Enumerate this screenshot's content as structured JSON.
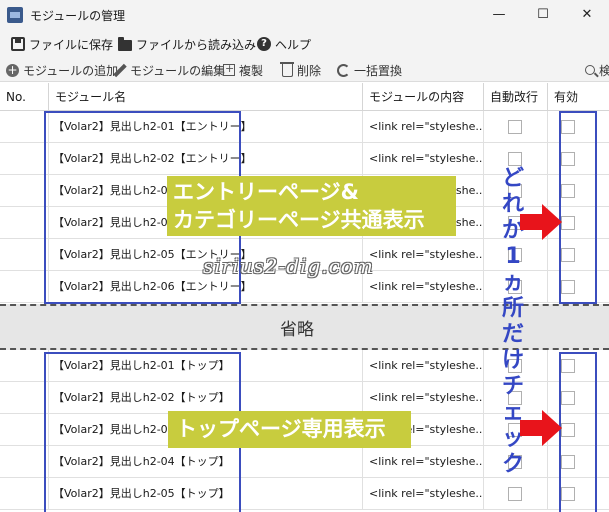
{
  "window": {
    "title": "モジュールの管理",
    "minimize": "—",
    "maximize": "☐",
    "close": "✕"
  },
  "menu": {
    "save_label": "ファイルに保存",
    "load_label": "ファイルから読み込み",
    "help_label": "ヘルプ"
  },
  "toolbar": {
    "add_label": "モジュールの追加",
    "edit_label": "モジュールの編集",
    "duplicate_label": "複製",
    "delete_label": "削除",
    "replace_label": "一括置換",
    "search_label": "検"
  },
  "table": {
    "columns": {
      "no": "No.",
      "name": "モジュール名",
      "content": "モジュールの内容",
      "auto_wrap": "自動改行",
      "enabled": "有効"
    },
    "rows_top": [
      {
        "name": "【Volar2】見出しh2-01【エントリー】",
        "content": "<link rel=\"styleshe..."
      },
      {
        "name": "【Volar2】見出しh2-02【エントリー】",
        "content": "<link rel=\"styleshe..."
      },
      {
        "name": "【Volar2】見出しh2-03",
        "content": "<link rel=\"styleshe..."
      },
      {
        "name": "【Volar2】見出しh2-04",
        "content": "<link rel=\"styleshe..."
      },
      {
        "name": "【Volar2】見出しh2-05【エントリー】",
        "content": "<link rel=\"styleshe..."
      },
      {
        "name": "【Volar2】見出しh2-06【エントリー】",
        "content": "<link rel=\"styleshe..."
      }
    ],
    "rows_bottom": [
      {
        "name": "【Volar2】見出しh2-01【トップ】",
        "content": "<link rel=\"styleshe..."
      },
      {
        "name": "【Volar2】見出しh2-02【トップ】",
        "content": "<link rel=\"styleshe..."
      },
      {
        "name": "【Volar2】見出しh2-03",
        "content": "<link rel=\"styleshe..."
      },
      {
        "name": "【Volar2】見出しh2-04【トップ】",
        "content": "<link rel=\"styleshe..."
      },
      {
        "name": "【Volar2】見出しh2-05【トップ】",
        "content": "<link rel=\"styleshe..."
      }
    ]
  },
  "annotations": {
    "callout_entry_line1": "エントリーページ&",
    "callout_entry_line2": "カテゴリーページ共通表示",
    "callout_top": "トップページ専用表示",
    "omitted": "省略",
    "vertical_chars": [
      "ど",
      "れ",
      "か",
      "1",
      "ヵ",
      "所",
      "だ",
      "け",
      "チ",
      "ェ",
      "ッ",
      "ク"
    ],
    "watermark": "sirius2-dig.com",
    "frame_color": "#3b4dbe",
    "callout_color": "#c8cc3e",
    "arrow_color": "#e8141b"
  }
}
